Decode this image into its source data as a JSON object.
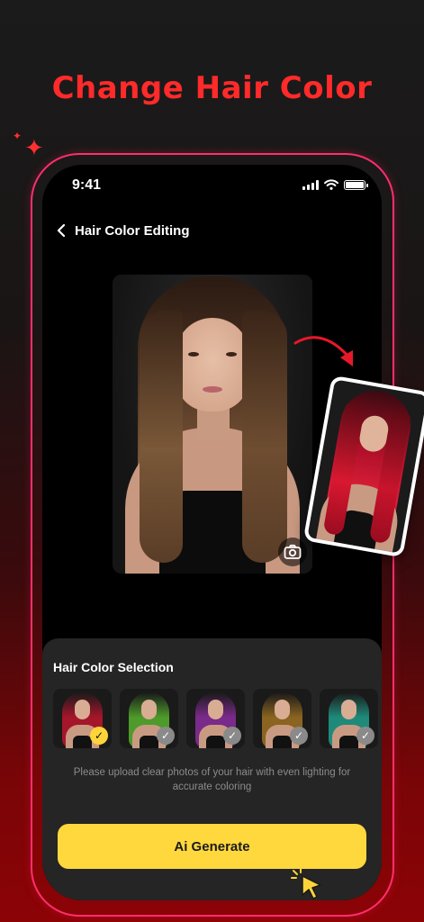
{
  "headline": "Change Hair Color",
  "status_bar": {
    "time": "9:41"
  },
  "nav": {
    "title": "Hair Color Editing"
  },
  "panel": {
    "title": "Hair Color Selection",
    "swatches": [
      {
        "color": "red",
        "hex": "#a5162a",
        "selected": true
      },
      {
        "color": "green",
        "hex": "#4e9a2a",
        "selected": false
      },
      {
        "color": "purple",
        "hex": "#7a2a8a",
        "selected": false
      },
      {
        "color": "golden-brown",
        "hex": "#8a6420",
        "selected": false
      },
      {
        "color": "teal",
        "hex": "#1f8a7a",
        "selected": false
      }
    ],
    "hint": "Please upload clear photos of your hair with even lighting for accurate coloring",
    "generate_label": "Ai Generate"
  },
  "colors": {
    "accent": "#ff2a2a",
    "frame_border": "#ff2e6c",
    "button": "#ffd83d"
  },
  "icons": [
    "back-chevron-icon",
    "camera-icon",
    "curved-arrow-icon",
    "check-icon",
    "pointer-cursor-icon",
    "sparkle-icon",
    "wifi-icon",
    "signal-icon",
    "battery-icon"
  ]
}
